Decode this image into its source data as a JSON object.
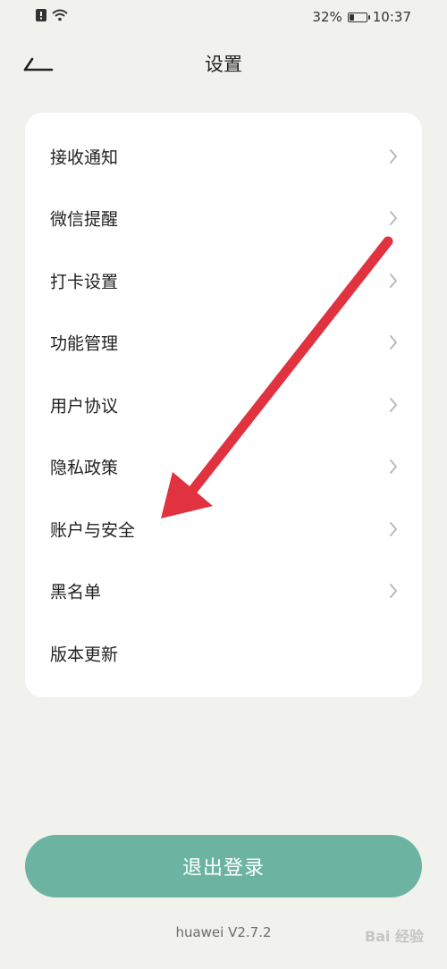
{
  "status_bar": {
    "battery_percent": "32%",
    "battery_level": 0.32,
    "time": "10:37",
    "icons": [
      "alert-icon",
      "wifi-icon",
      "battery-icon"
    ]
  },
  "header": {
    "back_icon": "back-arrow-icon",
    "title": "设置"
  },
  "settings": {
    "items": [
      {
        "label": "接收通知",
        "chevron": true
      },
      {
        "label": "微信提醒",
        "chevron": true
      },
      {
        "label": "打卡设置",
        "chevron": true
      },
      {
        "label": "功能管理",
        "chevron": true
      },
      {
        "label": "用户协议",
        "chevron": true
      },
      {
        "label": "隐私政策",
        "chevron": true
      },
      {
        "label": "账户与安全",
        "chevron": true
      },
      {
        "label": "黑名单",
        "chevron": true
      },
      {
        "label": "版本更新",
        "chevron": false
      }
    ]
  },
  "logout": {
    "label": "退出登录"
  },
  "footer": {
    "version": "huawei V2.7.2"
  },
  "watermark": {
    "text": "Bai 经验"
  },
  "annotation": {
    "arrow_icon": "red-arrow-annotation"
  },
  "colors": {
    "background": "#f1f2ee",
    "card": "#ffffff",
    "accent": "#6cb4a1",
    "annotation_red": "#e0323f"
  }
}
